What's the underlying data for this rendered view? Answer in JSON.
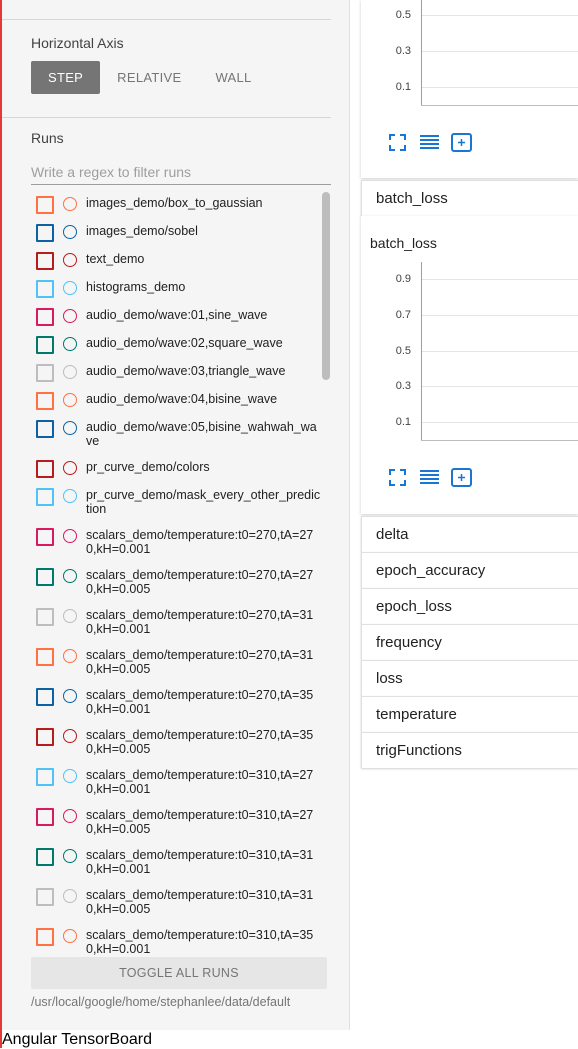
{
  "sidebar": {
    "horizontal_axis": {
      "title": "Horizontal Axis",
      "options": [
        "STEP",
        "RELATIVE",
        "WALL"
      ],
      "selected": "STEP"
    },
    "runs": {
      "title": "Runs",
      "filter_placeholder": "Write a regex to filter runs",
      "items": [
        {
          "name": "images_demo/box_to_gaussian",
          "color": "#ff7043"
        },
        {
          "name": "images_demo/sobel",
          "color": "#0c63a4"
        },
        {
          "name": "text_demo",
          "color": "#b71c1c"
        },
        {
          "name": "histograms_demo",
          "color": "#4fc3f7"
        },
        {
          "name": "audio_demo/wave:01,sine_wave",
          "color": "#d81b60"
        },
        {
          "name": "audio_demo/wave:02,square_wave",
          "color": "#00796b"
        },
        {
          "name": "audio_demo/wave:03,triangle_wave",
          "color": "#bdbdbd"
        },
        {
          "name": "audio_demo/wave:04,bisine_wave",
          "color": "#ff7043"
        },
        {
          "name": "audio_demo/wave:05,bisine_wahwah_wave",
          "color": "#0c63a4"
        },
        {
          "name": "pr_curve_demo/colors",
          "color": "#b71c1c"
        },
        {
          "name": "pr_curve_demo/mask_every_other_prediction",
          "color": "#4fc3f7"
        },
        {
          "name": "scalars_demo/temperature:t0=270,tA=270,kH=0.001",
          "color": "#d81b60"
        },
        {
          "name": "scalars_demo/temperature:t0=270,tA=270,kH=0.005",
          "color": "#00796b"
        },
        {
          "name": "scalars_demo/temperature:t0=270,tA=310,kH=0.001",
          "color": "#bdbdbd"
        },
        {
          "name": "scalars_demo/temperature:t0=270,tA=310,kH=0.005",
          "color": "#ff7043"
        },
        {
          "name": "scalars_demo/temperature:t0=270,tA=350,kH=0.001",
          "color": "#0c63a4"
        },
        {
          "name": "scalars_demo/temperature:t0=270,tA=350,kH=0.005",
          "color": "#b71c1c"
        },
        {
          "name": "scalars_demo/temperature:t0=310,tA=270,kH=0.001",
          "color": "#4fc3f7"
        },
        {
          "name": "scalars_demo/temperature:t0=310,tA=270,kH=0.005",
          "color": "#d81b60"
        },
        {
          "name": "scalars_demo/temperature:t0=310,tA=310,kH=0.001",
          "color": "#00796b"
        },
        {
          "name": "scalars_demo/temperature:t0=310,tA=310,kH=0.005",
          "color": "#bdbdbd"
        },
        {
          "name": "scalars_demo/temperature:t0=310,tA=350,kH=0.001",
          "color": "#ff7043"
        }
      ],
      "toggle_all_label": "TOGGLE ALL RUNS",
      "logdir": "/usr/local/google/home/stephanlee/data/default"
    }
  },
  "main": {
    "top_chart": {
      "ticks": [
        "0.5",
        "0.3",
        "0.1"
      ]
    },
    "groups": {
      "batch_loss": "batch_loss",
      "delta": "delta",
      "epoch_accuracy": "epoch_accuracy",
      "epoch_loss": "epoch_loss",
      "frequency": "frequency",
      "loss": "loss",
      "temperature": "temperature",
      "trigFunctions": "trigFunctions"
    },
    "batch_loss_chart": {
      "title": "batch_loss",
      "ticks": [
        "0.9",
        "0.7",
        "0.5",
        "0.3",
        "0.1"
      ]
    },
    "icon_color": "#1976d2"
  },
  "footer": {
    "text": "Angular TensorBoard"
  }
}
